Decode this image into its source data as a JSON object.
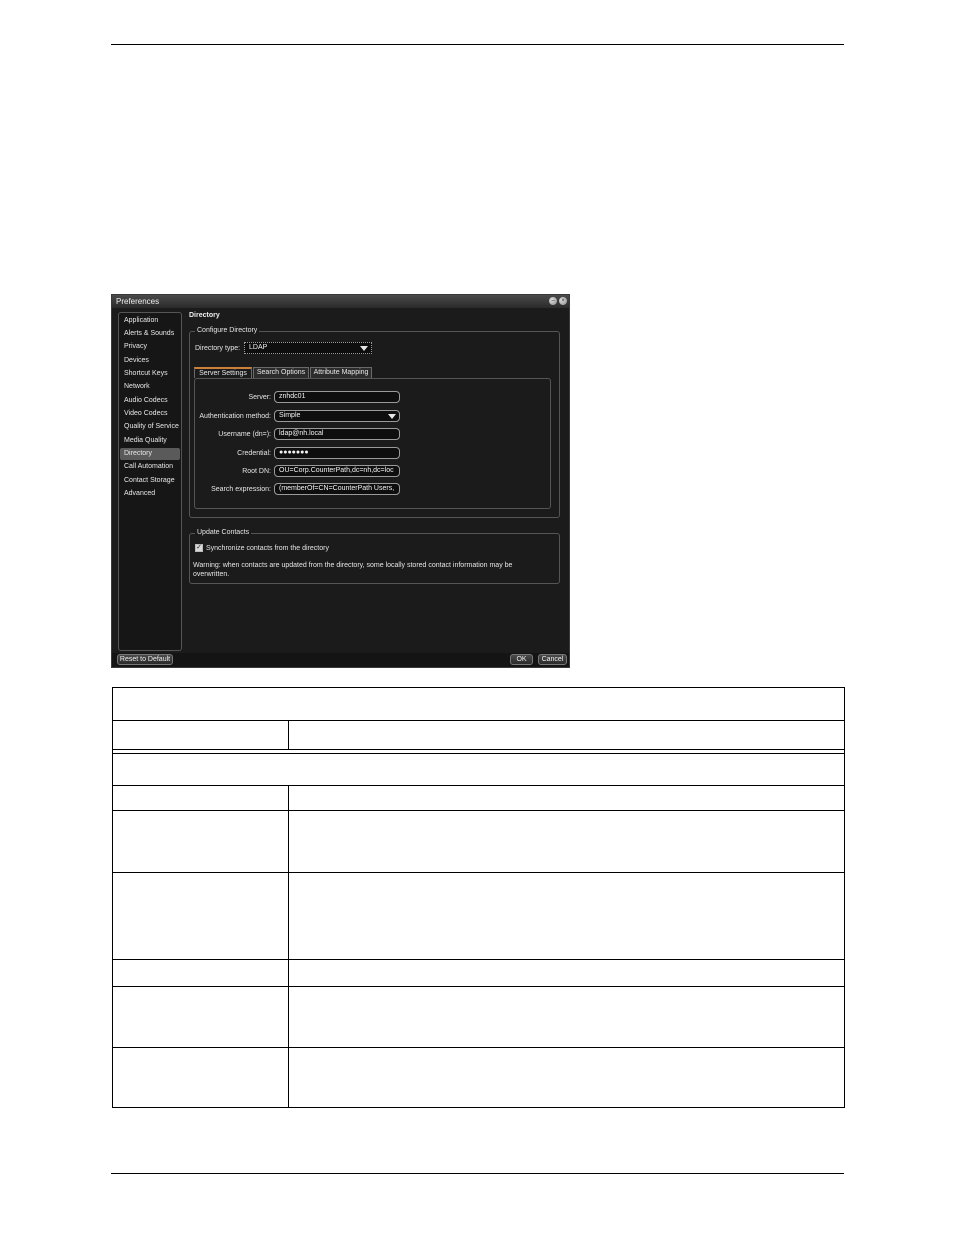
{
  "window": {
    "title": "Preferences",
    "heading": "Directory",
    "sidebar": [
      {
        "label": "Application",
        "active": false
      },
      {
        "label": "Alerts & Sounds",
        "active": false
      },
      {
        "label": "Privacy",
        "active": false
      },
      {
        "label": "Devices",
        "active": false
      },
      {
        "label": "Shortcut Keys",
        "active": false
      },
      {
        "label": "Network",
        "active": false
      },
      {
        "label": "Audio Codecs",
        "active": false
      },
      {
        "label": "Video Codecs",
        "active": false
      },
      {
        "label": "Quality of Service",
        "active": false
      },
      {
        "label": "Media Quality",
        "active": false
      },
      {
        "label": "Directory",
        "active": true
      },
      {
        "label": "Call Automation",
        "active": false
      },
      {
        "label": "Contact Storage",
        "active": false
      },
      {
        "label": "Advanced",
        "active": false
      }
    ],
    "configure": {
      "group_label": "Configure Directory",
      "type_label": "Directory type:",
      "type_value": "LDAP"
    },
    "tabs": [
      "Server Settings",
      "Search Options",
      "Attribute Mapping"
    ],
    "server": {
      "server_label": "Server:",
      "server_value": "znhdc01",
      "auth_label": "Authentication method:",
      "auth_value": "Simple",
      "username_label": "Username (dn=):",
      "username_value": "ldap@nh.local",
      "credential_label": "Credential:",
      "credential_value": "●●●●●●●",
      "rootdn_label": "Root DN:",
      "rootdn_value": "OU=Corp.CounterPath,dc=nh,dc=loc",
      "search_label": "Search expression:",
      "search_value": "(memberOf=CN=CounterPath Users,"
    },
    "update": {
      "group_label": "Update Contacts",
      "sync_label": "Synchronize contacts from the directory",
      "sync_checked": true,
      "warning": "Warning: when contacts are updated from the directory, some locally stored contact information may be overwritten."
    },
    "buttons": {
      "reset": "Reset to Default",
      "ok": "OK",
      "cancel": "Cancel"
    }
  }
}
